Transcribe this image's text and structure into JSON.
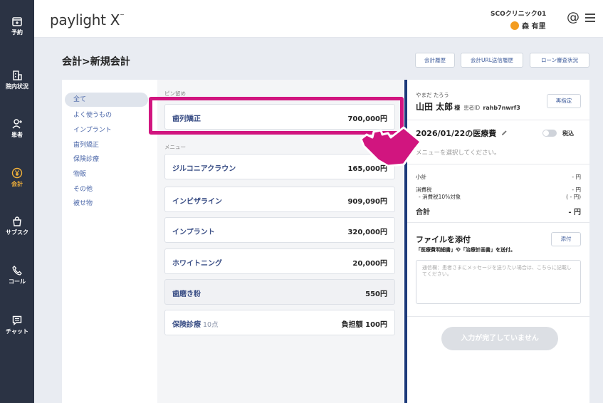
{
  "sidebar": {
    "items": [
      {
        "label": "予約",
        "icon": "calendar-icon"
      },
      {
        "label": "院内状況",
        "icon": "building-icon"
      },
      {
        "label": "患者",
        "icon": "add-user-icon"
      },
      {
        "label": "会計",
        "icon": "yen-icon",
        "active": true
      },
      {
        "label": "サブスク",
        "icon": "shopping-bag-icon"
      },
      {
        "label": "コール",
        "icon": "phone-icon"
      },
      {
        "label": "チャット",
        "icon": "chat-icon"
      }
    ],
    "active_color": "#f3b23a"
  },
  "header": {
    "logo": "paylight X",
    "logo_mark": "~",
    "clinic": "SCOクリニック01",
    "user": "森 有里",
    "at_icon": "@"
  },
  "page": {
    "title": "会計>新規会計",
    "buttons": [
      "会計履歴",
      "会計URL送信履歴",
      "ローン審査状況"
    ]
  },
  "categories": [
    "全て",
    "よく使うもの",
    "インプラント",
    "歯列矯正",
    "保険診療",
    "物販",
    "その他",
    "被せ物"
  ],
  "menu": {
    "pinned_label": "ピン留め",
    "pinned": [
      {
        "name": "歯列矯正",
        "price": "700,000円"
      }
    ],
    "section_label": "メニュー",
    "items": [
      {
        "name": "ジルコニアクラウン",
        "price": "165,000円"
      },
      {
        "name": "インビザライン",
        "price": "909,090円"
      },
      {
        "name": "インプラント",
        "price": "320,000円"
      },
      {
        "name": "ホワイトニング",
        "price": "20,000円"
      },
      {
        "name": "歯磨き粉",
        "price": "550円"
      },
      {
        "name": "保険診療",
        "sub": "10点",
        "price": "負担額 100円"
      }
    ]
  },
  "patient": {
    "kana": "やまだ たろう",
    "name": "山田 太郎",
    "honorific": "様",
    "id_label": "患者ID",
    "id": "rahb7nwrf3",
    "reset_label": "再指定"
  },
  "fee": {
    "date_title": "2026/01/22の医療費",
    "tax_toggle_label": "税込",
    "hint": "メニューを選択してください。",
    "subtotal_label": "小計",
    "subtotal_value": "- 円",
    "tax_label": "消費税",
    "tax_value": "- 円",
    "tax10_label": "- 消費税10%対象",
    "tax10_value": "( - 円)",
    "total_label": "合計",
    "total_value": "- 円"
  },
  "attach": {
    "title": "ファイルを添付",
    "subtitle": "「医療費明細書」や「治療計画書」を送付。",
    "button": "添付",
    "message_placeholder": "通信欄：患者さまにメッセージを送りたい場合は、こちらに記載してください。"
  },
  "submit_label": "入力が完了していません",
  "colors": {
    "sidebar_bg": "#2b3344",
    "highlight": "#d1157f",
    "accent_blue": "#3b4f86",
    "divider": "#1d3a7a"
  }
}
